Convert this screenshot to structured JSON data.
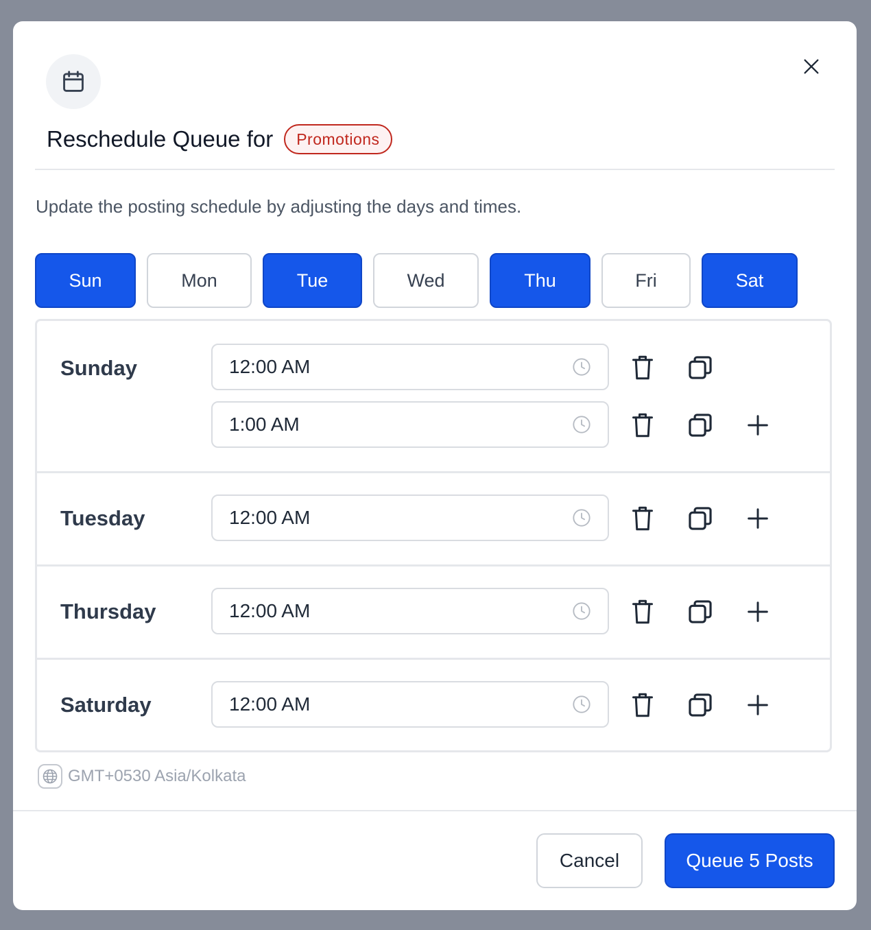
{
  "modal": {
    "title": "Reschedule Queue for",
    "tag": "Promotions",
    "description": "Update the posting schedule by adjusting the days and times."
  },
  "day_toggles": [
    {
      "label": "Sun",
      "selected": true
    },
    {
      "label": "Mon",
      "selected": false
    },
    {
      "label": "Tue",
      "selected": true
    },
    {
      "label": "Wed",
      "selected": false
    },
    {
      "label": "Thu",
      "selected": true
    },
    {
      "label": "Fri",
      "selected": false
    },
    {
      "label": "Sat",
      "selected": true
    }
  ],
  "schedule": [
    {
      "day": "Sunday",
      "times": [
        "12:00 AM",
        "1:00 AM"
      ]
    },
    {
      "day": "Tuesday",
      "times": [
        "12:00 AM"
      ]
    },
    {
      "day": "Thursday",
      "times": [
        "12:00 AM"
      ]
    },
    {
      "day": "Saturday",
      "times": [
        "12:00 AM"
      ]
    }
  ],
  "timezone": "GMT+0530 Asia/Kolkata",
  "footer": {
    "cancel_label": "Cancel",
    "submit_label": "Queue 5 Posts"
  },
  "colors": {
    "primary": "#1557ea",
    "tag": "#c0271d",
    "overlay": "#868c99"
  },
  "icons": {
    "header": "calendar-icon",
    "close": "close-icon",
    "time": "clock-icon",
    "delete": "trash-icon",
    "duplicate": "copy-icon",
    "add": "plus-icon",
    "timezone": "globe-icon"
  }
}
